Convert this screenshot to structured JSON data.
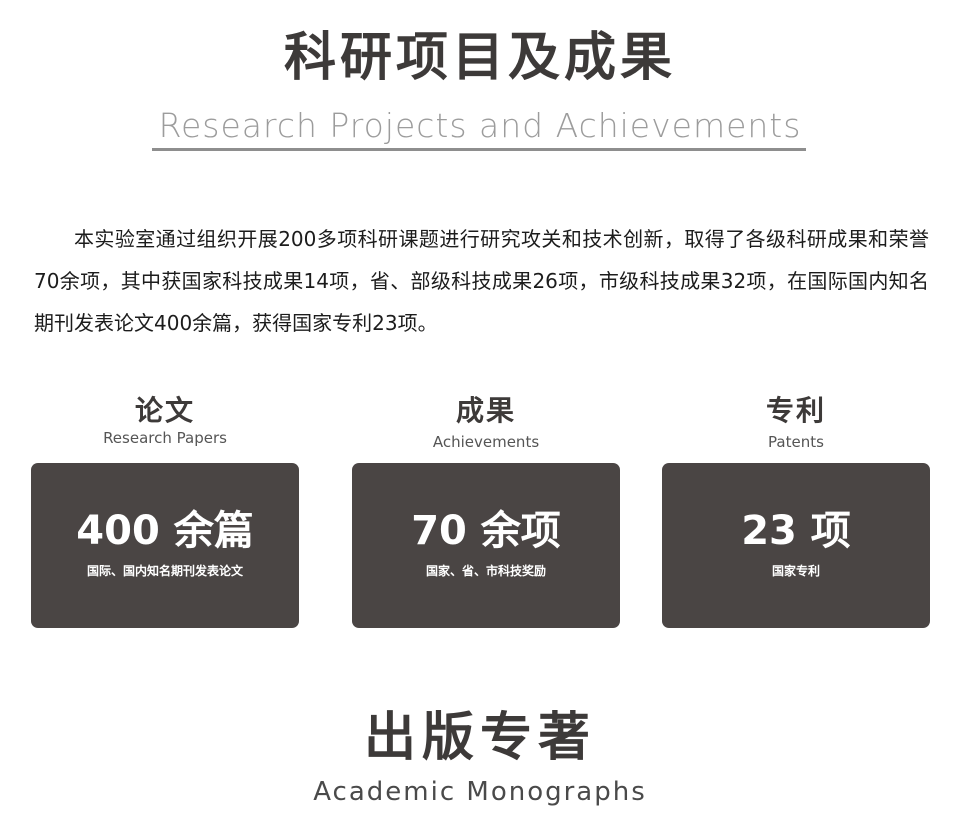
{
  "research": {
    "title_cn": "科研项目及成果",
    "title_en": "Research  Projects and  Achievements",
    "intro": "本实验室通过组织开展200多项科研课题进行研究攻关和技术创新，取得了各级科研成果和荣誉70余项，其中获国家科技成果14项，省、部级科技成果26项，市级科技成果32项，在国际国内知名期刊发表论文400余篇，获得国家专利23项。"
  },
  "stats": [
    {
      "label_cn": "论文",
      "label_en": "Research Papers",
      "value": "400 余篇",
      "caption": "国际、国内知名期刊发表论文"
    },
    {
      "label_cn": "成果",
      "label_en": "Achievements",
      "value": "70 余项",
      "caption": "国家、省、市科技奖励"
    },
    {
      "label_cn": "专利",
      "label_en": "Patents",
      "value": "23 项",
      "caption": "国家专利"
    }
  ],
  "monographs": {
    "title_cn": "出版专著",
    "title_en": "Academic Monographs"
  },
  "colors": {
    "card_bg": "#4a4544",
    "title": "#3d3a39",
    "subtitle": "#9c9c9c"
  }
}
